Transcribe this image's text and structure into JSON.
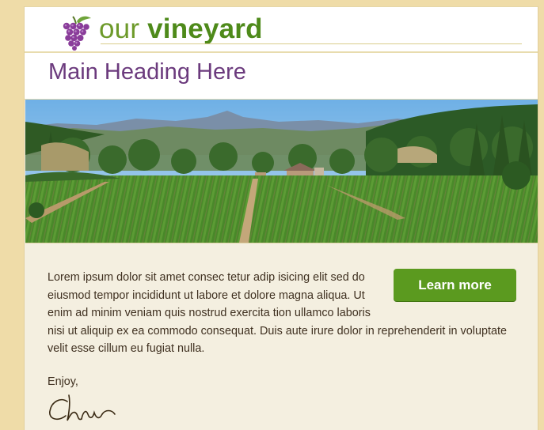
{
  "logo": {
    "word1": "our",
    "word2": "vineyard",
    "icon": "grapes-icon",
    "colors": {
      "word1": "#6d9a2a",
      "word2": "#4e8a1a",
      "grapes": "#8a3d9a"
    }
  },
  "page": {
    "title": "Main Heading Here",
    "title_color": "#6b3a7d",
    "background": "#efdca8",
    "content_background": "#f4efe0"
  },
  "hero": {
    "scene": "vineyard-landscape-image"
  },
  "cta": {
    "label": "Learn more",
    "color": "#5b9a1f"
  },
  "body": {
    "text": "Lorem ipsum dolor sit amet consec tetur adip isicing elit sed do eiusmod tempor incididunt ut labore et dolore magna aliqua. Ut enim ad minim veniam quis nostrud exercita tion ullamco laboris nisi ut aliquip ex ea commodo consequat. Duis aute irure dolor in reprehenderit in voluptate velit esse cillum eu fugiat nulla."
  },
  "closing": {
    "greeting": "Enjoy,"
  }
}
